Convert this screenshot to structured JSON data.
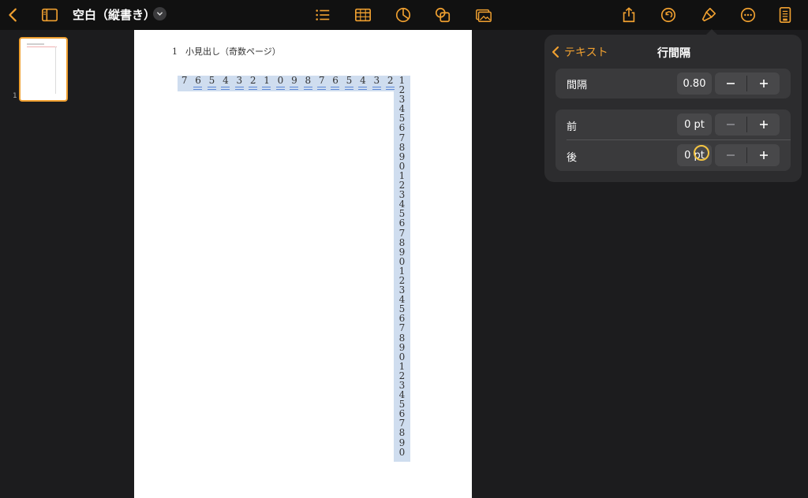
{
  "toolbar": {
    "doc_title": "空白（縦書き）",
    "icons": [
      "back-chevron-icon",
      "sidebar-icon",
      "list-icon",
      "table-icon",
      "chart-icon",
      "shape-icon",
      "media-icon",
      "share-icon",
      "undo-icon",
      "format-brush-icon",
      "more-icon",
      "document-icon"
    ]
  },
  "sidebar": {
    "page_number": "1"
  },
  "document": {
    "heading_number": "1",
    "heading_text": "小見出し（奇数ページ）",
    "horizontal_digits": [
      "7",
      "6",
      "5",
      "4",
      "3",
      "2",
      "1",
      "0",
      "9",
      "8",
      "7",
      "6",
      "5",
      "4",
      "3",
      "2"
    ],
    "vertical_digits": [
      "1",
      "2",
      "3",
      "4",
      "5",
      "6",
      "7",
      "8",
      "9",
      "0",
      "1",
      "2",
      "3",
      "4",
      "5",
      "6",
      "7",
      "8",
      "9",
      "0",
      "1",
      "2",
      "3",
      "4",
      "5",
      "6",
      "7",
      "8",
      "9",
      "0",
      "1",
      "2",
      "3",
      "4",
      "5",
      "6",
      "7",
      "8",
      "9",
      "0"
    ]
  },
  "popover": {
    "back_label": "テキスト",
    "title": "行間隔",
    "spacing": {
      "label": "間隔",
      "value": "0.80"
    },
    "before": {
      "label": "前",
      "value": "0 pt"
    },
    "after": {
      "label": "後",
      "value": "0 pt"
    }
  },
  "colors": {
    "accent": "#f0a030",
    "selection": "#cfddef",
    "popover_bg": "#2c2c2e",
    "cursor_ring": "#f5c542"
  }
}
